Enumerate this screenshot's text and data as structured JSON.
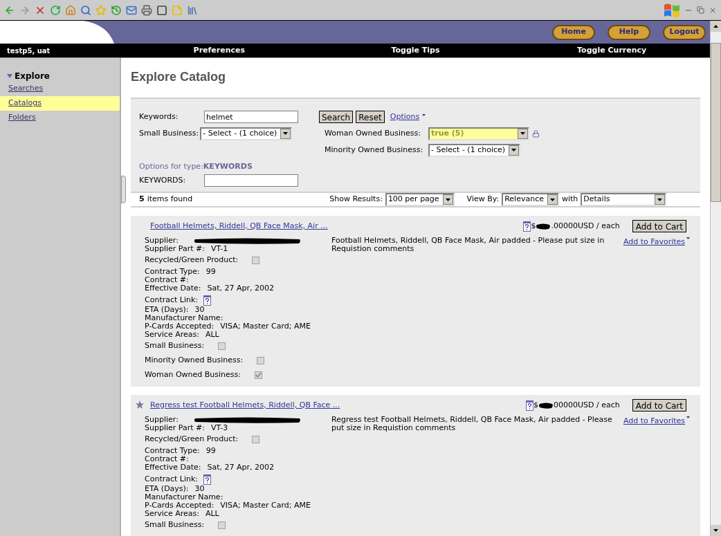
{
  "header": {
    "buttons": [
      "Home",
      "Help",
      "Logout"
    ]
  },
  "nav": {
    "user": "testp5, uat",
    "links": [
      "Preferences",
      "Toggle Tips",
      "Toggle Currency"
    ]
  },
  "sidebar": {
    "section": {
      "title": "Explore",
      "expanded": true
    },
    "items": [
      {
        "label": "Searches",
        "selected": false
      },
      {
        "label": "Catalogs",
        "selected": true
      },
      {
        "label": "Folders",
        "selected": false
      }
    ]
  },
  "page_title": "Explore Catalog",
  "search": {
    "keywords": {
      "label": "Keywords:",
      "value": "helmet"
    },
    "buttons": [
      "Search",
      "Reset"
    ],
    "options_link": "Options",
    "filters": [
      {
        "label": "Small Business:",
        "value": "- Select - (1 choice)",
        "highlighted": false,
        "locked": false
      },
      {
        "label": "Woman Owned Business:",
        "value": "true (5)",
        "highlighted": true,
        "locked": true
      },
      {
        "label": "Minority Owned Business:",
        "value": "- Select - (1 choice)",
        "highlighted": false,
        "locked": false
      }
    ],
    "options_for_type": {
      "label": "Options for type:",
      "type": "KEYWORDS"
    },
    "type_field": {
      "label": "KEYWORDS:"
    }
  },
  "results": {
    "count": "5",
    "count_label": "items found",
    "show_results": {
      "label": "Show Results:",
      "value": "100 per page"
    },
    "view_by": {
      "label": "View By:",
      "value": "Relevance"
    },
    "with": {
      "label": "with",
      "value": "Details"
    }
  },
  "items": [
    {
      "starred": false,
      "title": "Football Helmets, Riddell, QB Face Mask, Air ...",
      "price_prefix": "$",
      "price_suffix": ".00000USD / each",
      "add_button": "Add to Cart",
      "favorites": "Add to Favorites",
      "description": "Football Helmets, Riddell, QB Face Mask, Air padded - Please put size in Requistion comments",
      "fields": [
        {
          "kind": "redacted",
          "label": "Supplier:"
        },
        {
          "kind": "text",
          "label": "Supplier Part #:",
          "value": "VT-1"
        },
        {
          "kind": "checkbox",
          "label": "Recycled/Green Product:",
          "checked": false
        },
        {
          "kind": "text",
          "label": "Contract Type:",
          "value": "99"
        },
        {
          "kind": "text",
          "label": "Contract #:"
        },
        {
          "kind": "text",
          "label": "Effective Date:",
          "value": "Sat, 27 Apr, 2002"
        },
        {
          "kind": "link_icon",
          "label": "Contract Link:"
        },
        {
          "kind": "text",
          "label": "ETA (Days):",
          "value": "30"
        },
        {
          "kind": "text",
          "label": "Manufacturer Name:"
        },
        {
          "kind": "text",
          "label": "P-Cards Accepted:",
          "value": "VISA; Master Card; AME"
        },
        {
          "kind": "text",
          "label": "Service Areas:",
          "value": "ALL"
        },
        {
          "kind": "checkbox",
          "label": "Small Business:",
          "checked": false
        },
        {
          "kind": "checkbox",
          "label": "Minority Owned Business:",
          "checked": false
        },
        {
          "kind": "checkbox",
          "label": "Woman Owned Business:",
          "checked": true
        }
      ]
    },
    {
      "starred": true,
      "title": "Regress test Football Helmets, Riddell, QB Face ...",
      "price_prefix": "$",
      "price_suffix": "00000USD / each",
      "add_button": "Add to Cart",
      "favorites": "Add to Favorites",
      "description": "Regress test Football Helmets, Riddell, QB Face Mask, Air padded - Please put size in Requistion comments",
      "fields": [
        {
          "kind": "redacted",
          "label": "Supplier:"
        },
        {
          "kind": "text",
          "label": "Supplier Part #:",
          "value": "VT-3"
        },
        {
          "kind": "checkbox",
          "label": "Recycled/Green Product:",
          "checked": false
        },
        {
          "kind": "text",
          "label": "Contract Type:",
          "value": "99"
        },
        {
          "kind": "text",
          "label": "Contract #:"
        },
        {
          "kind": "text",
          "label": "Effective Date:",
          "value": "Sat, 27 Apr, 2002"
        },
        {
          "kind": "link_icon",
          "label": "Contract Link:"
        },
        {
          "kind": "text",
          "label": "ETA (Days):",
          "value": "30"
        },
        {
          "kind": "text",
          "label": "Manufacturer Name:"
        },
        {
          "kind": "text",
          "label": "P-Cards Accepted:",
          "value": "VISA; Master Card; AME"
        },
        {
          "kind": "text",
          "label": "Service Areas:",
          "value": "ALL"
        },
        {
          "kind": "checkbox",
          "label": "Small Business:",
          "checked": false
        }
      ]
    }
  ]
}
